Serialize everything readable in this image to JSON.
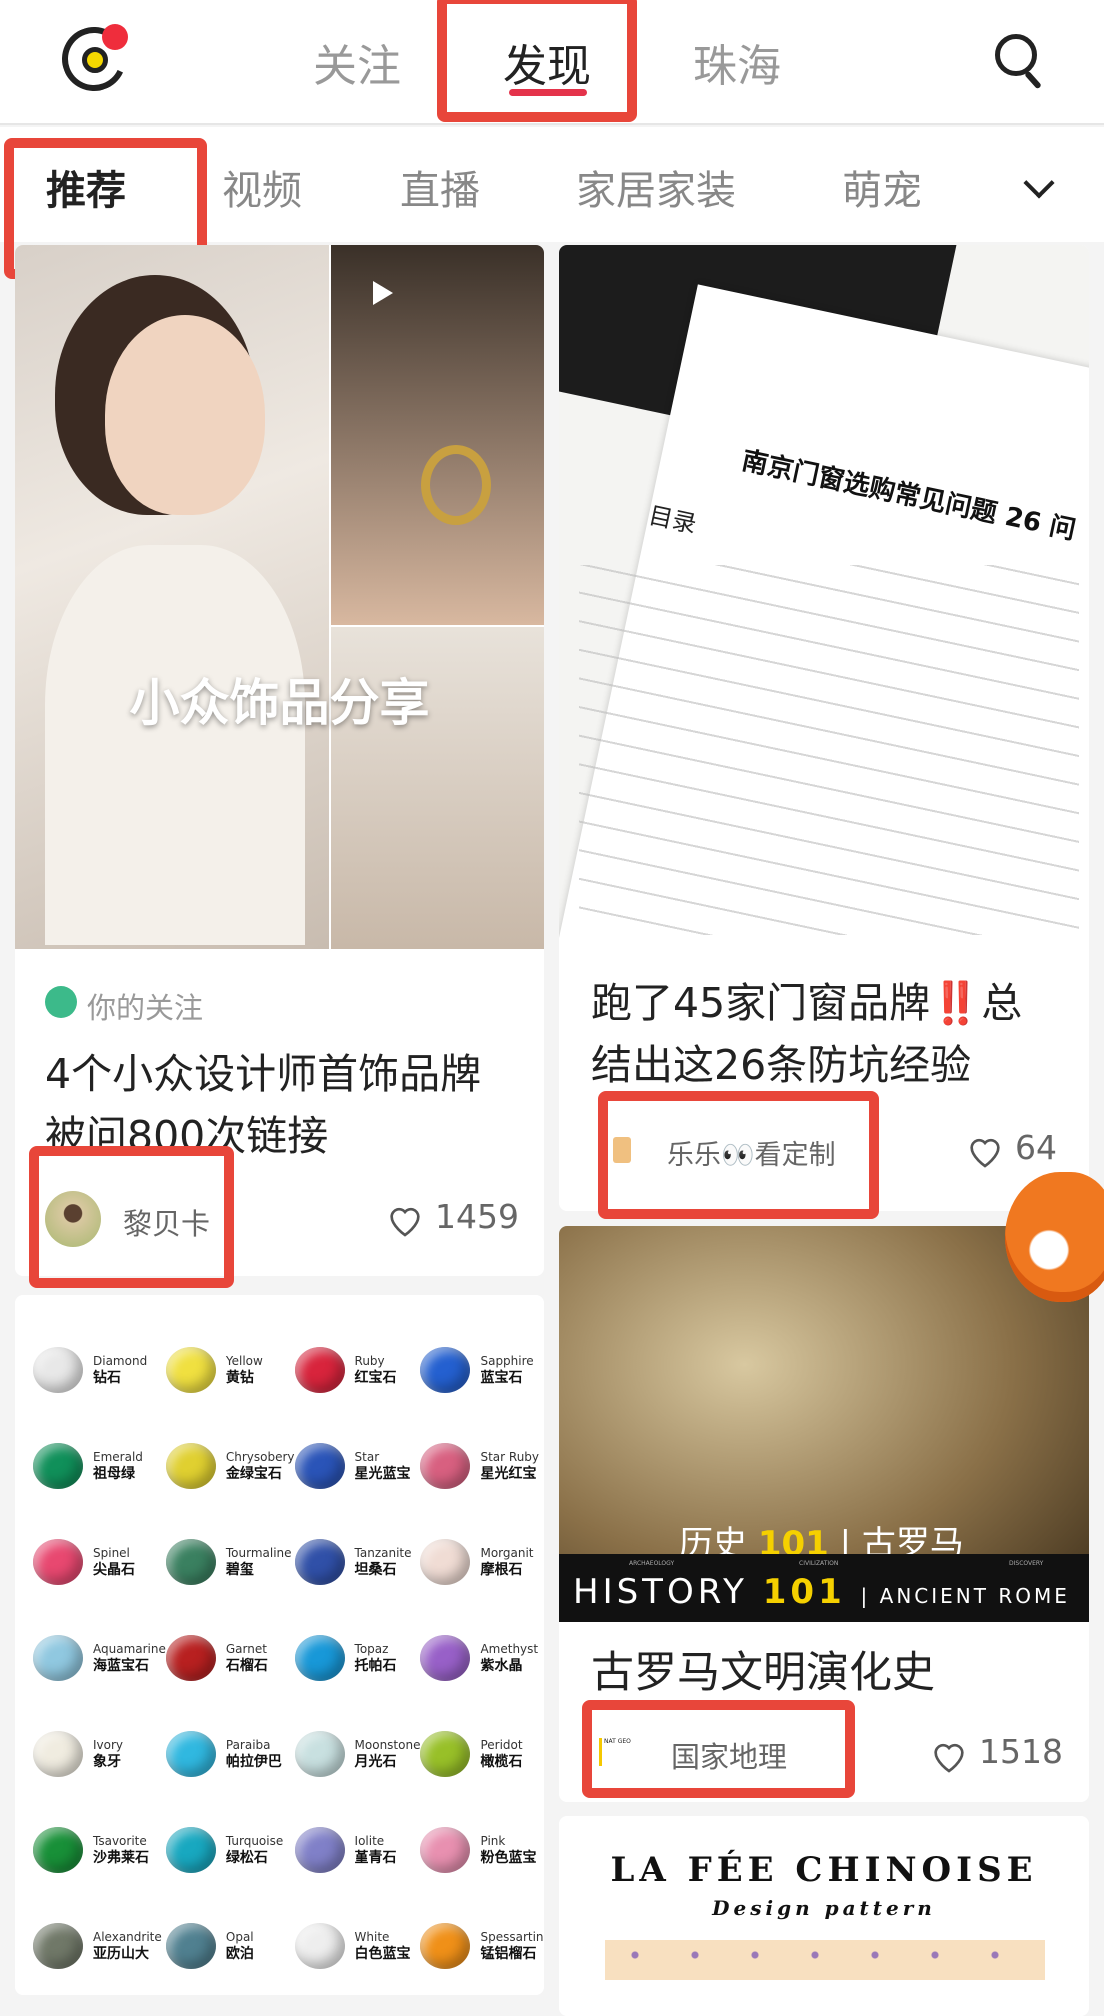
{
  "header": {
    "tabs": [
      {
        "label": "关注"
      },
      {
        "label": "发现",
        "active": true
      },
      {
        "label": "珠海"
      }
    ],
    "logo_icon": "app-logo-icon",
    "search_icon": "search-icon",
    "accent": "#e4334b",
    "highlight": "#e8463a"
  },
  "channels": {
    "items": [
      {
        "label": "推荐",
        "active": true
      },
      {
        "label": "视频"
      },
      {
        "label": "直播"
      },
      {
        "label": "家居家装"
      },
      {
        "label": "萌宠"
      }
    ],
    "more_icon": "chevron-down-icon"
  },
  "feed": {
    "card1": {
      "cover_text": "小众饰品分享",
      "video": true,
      "badge": "你的关注",
      "title": "4个小众设计师首饰品牌 被问800次链接",
      "author": "黎贝卡",
      "likes": "1459"
    },
    "card2": {
      "cover_heading": "南京门窗选购常见问题 26 问",
      "cover_sub": "目录",
      "title": "跑了45家门窗品牌‼️总结出这26条防坑经验",
      "author": "乐乐👀看定制",
      "likes": "64"
    },
    "card3": {
      "cover_cn": "历史",
      "cover_num": "101",
      "cover_cn2": "古罗马",
      "banner_tags": [
        "ARCHAEOLOGY",
        "CIVILIZATION",
        "DISCOVERY"
      ],
      "banner_en": "HISTORY",
      "banner_num": "101",
      "banner_en2": "ANCIENT ROME",
      "title": "古罗马文明演化史",
      "author": "国家地理",
      "author_logo": "NATIONAL GEOGRAPHIC 国家地理",
      "likes": "1518"
    },
    "card4": {
      "gems": [
        {
          "en": "Diamond",
          "cn": "钻石",
          "color": "#e8e8e8"
        },
        {
          "en": "Yellow",
          "cn": "黄钻",
          "color": "#f0e040"
        },
        {
          "en": "Ruby",
          "cn": "红宝石",
          "color": "#d8243c"
        },
        {
          "en": "Sapphire",
          "cn": "蓝宝石",
          "color": "#2460d0"
        },
        {
          "en": "Emerald",
          "cn": "祖母绿",
          "color": "#10905a"
        },
        {
          "en": "Chrysobery",
          "cn": "金绿宝石",
          "color": "#e0d030"
        },
        {
          "en": "Star",
          "cn": "星光蓝宝",
          "color": "#2a54b8"
        },
        {
          "en": "Star Ruby",
          "cn": "星光红宝",
          "color": "#d86080"
        },
        {
          "en": "Spinel",
          "cn": "尖晶石",
          "color": "#e84870"
        },
        {
          "en": "Tourmaline",
          "cn": "碧玺",
          "color": "#3a8060"
        },
        {
          "en": "Tanzanite",
          "cn": "坦桑石",
          "color": "#3050a8"
        },
        {
          "en": "Morganit",
          "cn": "摩根石",
          "color": "#f0dcd4"
        },
        {
          "en": "Aquamarine",
          "cn": "海蓝宝石",
          "color": "#90c8e0"
        },
        {
          "en": "Garnet",
          "cn": "石榴石",
          "color": "#b82020"
        },
        {
          "en": "Topaz",
          "cn": "托帕石",
          "color": "#1898d8"
        },
        {
          "en": "Amethyst",
          "cn": "紫水晶",
          "color": "#9860c8"
        },
        {
          "en": "Ivory",
          "cn": "象牙",
          "color": "#f0ece0"
        },
        {
          "en": "Paraiba",
          "cn": "帕拉伊巴",
          "color": "#30b8e0"
        },
        {
          "en": "Moonstone",
          "cn": "月光石",
          "color": "#c8e0e0"
        },
        {
          "en": "Peridot",
          "cn": "橄榄石",
          "color": "#98c028"
        },
        {
          "en": "Tsavorite",
          "cn": "沙弗莱石",
          "color": "#189038"
        },
        {
          "en": "Turquoise",
          "cn": "绿松石",
          "color": "#18a8c0"
        },
        {
          "en": "Iolite",
          "cn": "堇青石",
          "color": "#8080c8"
        },
        {
          "en": "Pink",
          "cn": "粉色蓝宝",
          "color": "#e890b0"
        },
        {
          "en": "Alexandrite",
          "cn": "亚历山大",
          "color": "#707868"
        },
        {
          "en": "Opal",
          "cn": "欧泊",
          "color": "#508090"
        },
        {
          "en": "White",
          "cn": "白色蓝宝",
          "color": "#eeeeee"
        },
        {
          "en": "Spessartine",
          "cn": "锰铝榴石",
          "color": "#f09018"
        }
      ]
    },
    "card5": {
      "brand": "LA FÉE CHINOISE",
      "tagline": "Design pattern"
    }
  }
}
